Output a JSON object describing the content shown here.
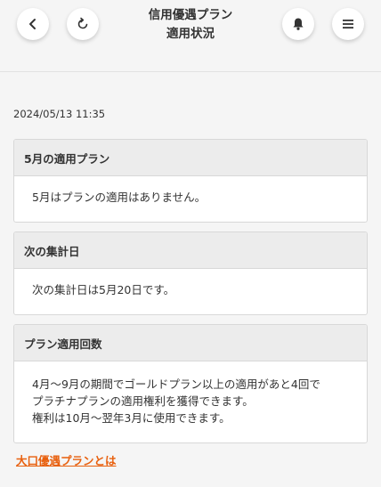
{
  "header": {
    "title_line1": "信用優遇プラン",
    "title_line2": "適用状況",
    "back_icon": "chevron-left-icon",
    "reload_icon": "refresh-icon",
    "bell_icon": "bell-icon",
    "menu_icon": "hamburger-menu-icon"
  },
  "timestamp": "2024/05/13 11:35",
  "cards": [
    {
      "heading": "5月の適用プラン",
      "lines": [
        "5月はプランの適用はありません。"
      ]
    },
    {
      "heading": "次の集計日",
      "lines": [
        "次の集計日は5月20日です。"
      ]
    },
    {
      "heading": "プラン適用回数",
      "lines": [
        "4月〜9月の期間でゴールドプラン以上の適用があと4回で",
        "プラチナプランの適用権利を獲得できます。",
        "権利は10月〜翌年3月に使用できます。"
      ]
    }
  ],
  "link_text": "大口優遇プランとは",
  "colors": {
    "accent_link": "#e8600e",
    "background": "#f5f5f5",
    "card_header": "#ececec"
  }
}
